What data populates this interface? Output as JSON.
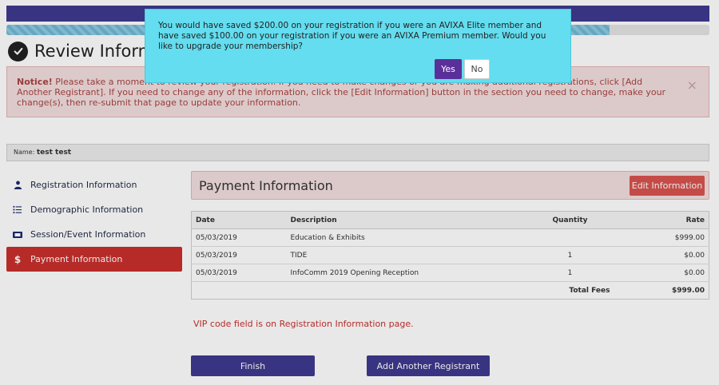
{
  "progress": {
    "value_percent": 85.8
  },
  "page": {
    "title": "Review Information"
  },
  "notice": {
    "label": "Notice!",
    "text": " Please take a moment to review your registration. If you need to make changes or you are making additional registrations, click [Add Another Registrant]. If you need to change any of the information, click the [Edit Information] button in the section you need to change, make your change(s), then re-submit that page to update your information.",
    "close": "×"
  },
  "namebar": {
    "label": "Name:",
    "value": "test test"
  },
  "sidebar": {
    "items": [
      {
        "label": "Registration Information",
        "icon": "user-icon"
      },
      {
        "label": "Demographic Information",
        "icon": "list-icon"
      },
      {
        "label": "Session/Event Information",
        "icon": "ticket-icon"
      },
      {
        "label": "Payment Information",
        "icon": "dollar-icon",
        "active": true
      }
    ]
  },
  "payment": {
    "title": "Payment Information",
    "edit_label": "Edit Information",
    "columns": {
      "date": "Date",
      "description": "Description",
      "quantity": "Quantity",
      "rate": "Rate"
    },
    "rows": [
      {
        "date": "05/03/2019",
        "description": "Education & Exhibits",
        "quantity": "",
        "rate": "$999.00"
      },
      {
        "date": "05/03/2019",
        "description": "TIDE",
        "quantity": "1",
        "rate": "$0.00"
      },
      {
        "date": "05/03/2019",
        "description": "InfoComm 2019 Opening Reception",
        "quantity": "1",
        "rate": "$0.00"
      }
    ],
    "total_label": "Total Fees",
    "total_value": "$999.00"
  },
  "vip_message": "VIP code field is on Registration Information page.",
  "actions": {
    "finish": "Finish",
    "add_registrant": "Add Another Registrant"
  },
  "modal": {
    "message": "You would have saved $200.00 on your registration if you were an AVIXA Elite member and have saved $100.00 on your registration if you were an AVIXA Premium member. Would you like to upgrade your membership?",
    "yes": "Yes",
    "no": "No"
  },
  "colors": {
    "brand": "#3f3a8e",
    "danger": "#c9302c",
    "modal_bg": "#63ddef"
  }
}
